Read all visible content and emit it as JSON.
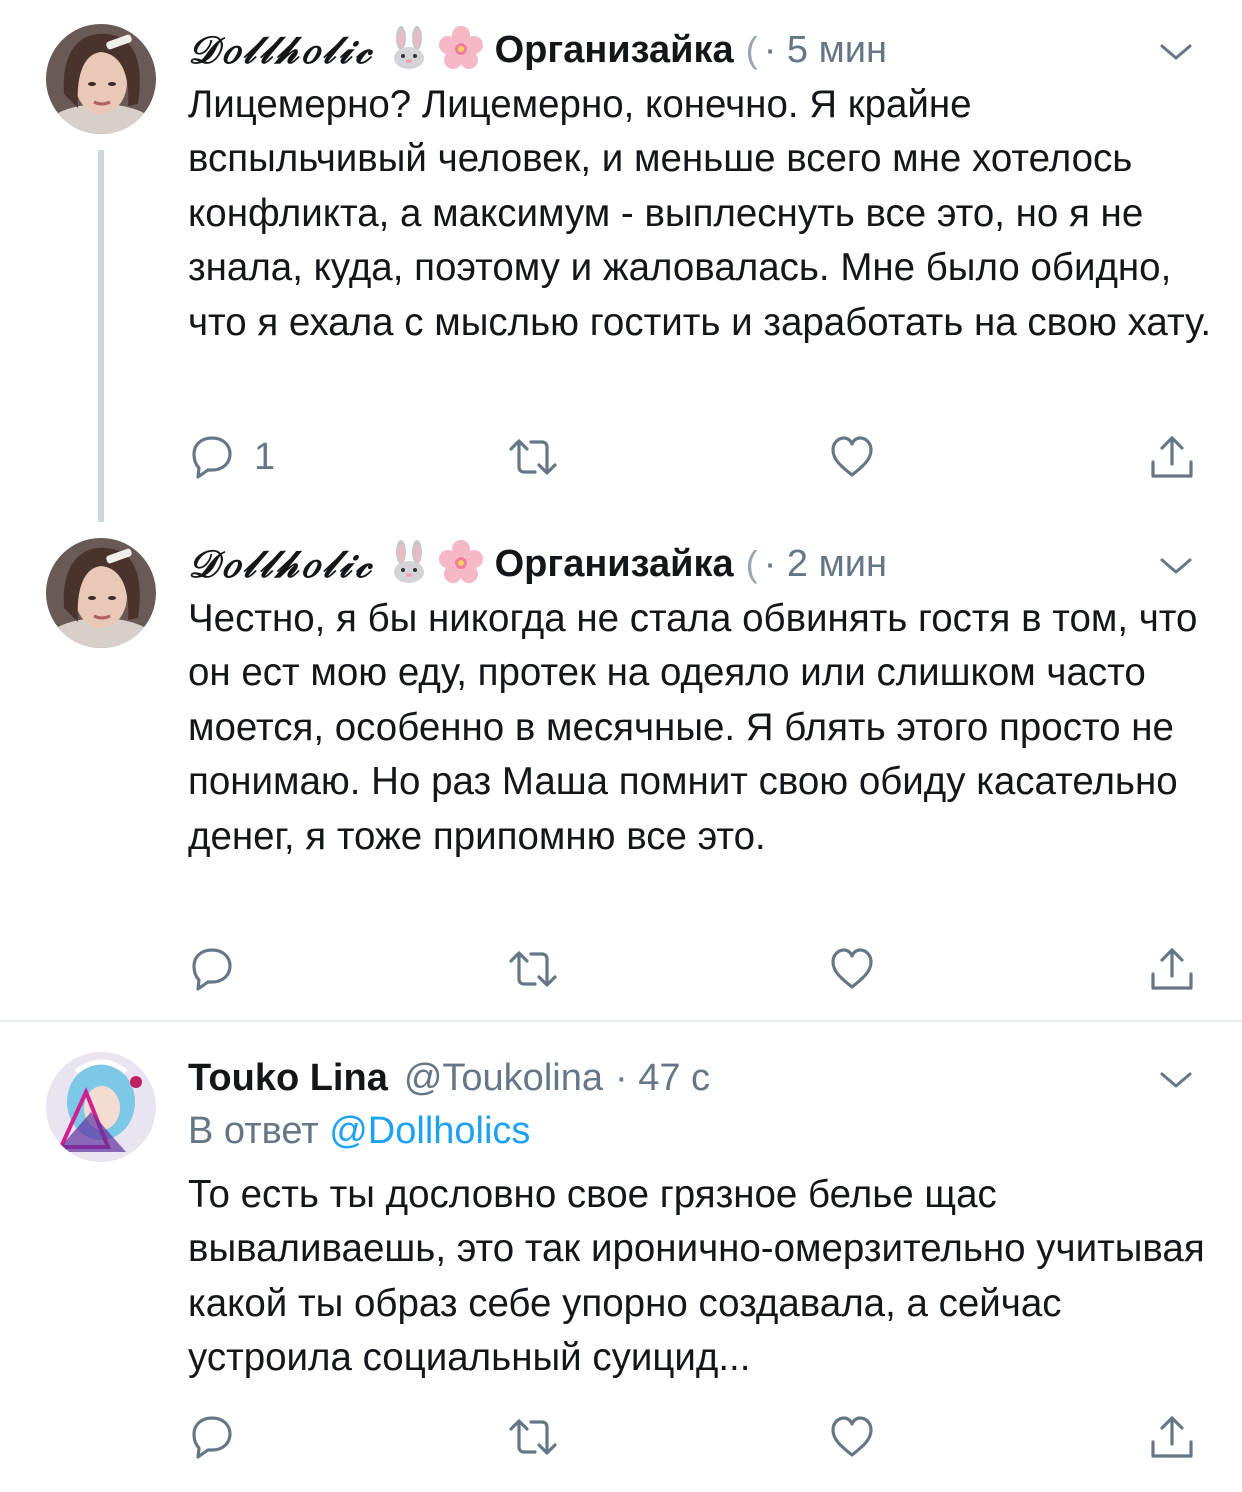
{
  "tweets": [
    {
      "display_name": "𝒟𝑜𝓁𝓁𝒽𝑜𝓁𝒾𝒸",
      "display_name_suffix": "Организайка",
      "truncation": "(",
      "time": "· 5 мин",
      "text": "Лицемерно? Лицемерно, конечно. Я крайне вспыльчивый человек, и меньше всего мне хотелось конфликта, а максимум - выплеснуть все это, но я не знала, куда, поэтому и жаловалась. Мне было обидно, что я ехала с мыслью гостить и заработать на свою хату.",
      "reply_count": "1",
      "icons": {
        "avatar": "avatar-photo",
        "emoji1": "rabbit-face-emoji",
        "emoji2": "cherry-blossom-emoji",
        "menu": "chevron-down-icon"
      }
    },
    {
      "display_name": "𝒟𝑜𝓁𝓁𝒽𝑜𝓁𝒾𝒸",
      "display_name_suffix": "Организайка",
      "truncation": "(",
      "time": "· 2 мин",
      "text": "Честно, я бы никогда не стала обвинять гостя в том, что он ест мою еду, протек на одеяло или слишком часто моется, особенно в месячные. Я блять этого просто не понимаю. Но раз Маша помнит свою обиду касательно денег, я тоже припомню все это.",
      "reply_count": ""
    },
    {
      "display_name": "Touko Lina",
      "handle": "@Toukolina",
      "time": "· 47 с",
      "reply_prefix": "В ответ",
      "reply_mention": "@Dollholics",
      "text": "То есть ты дословно свое грязное белье щас вываливаешь, это так иронично-омерзительно учитывая какой ты образ себе упорно создавала, а сейчас устроила социальный суицид...",
      "reply_count": ""
    }
  ],
  "action_icons": [
    "reply-icon",
    "retweet-icon",
    "like-icon",
    "share-icon"
  ],
  "colors": {
    "text": "#14171a",
    "muted": "#657786",
    "link": "#1da1f2",
    "thread_line": "#ccd6dd",
    "divider": "#e6ecf0"
  }
}
